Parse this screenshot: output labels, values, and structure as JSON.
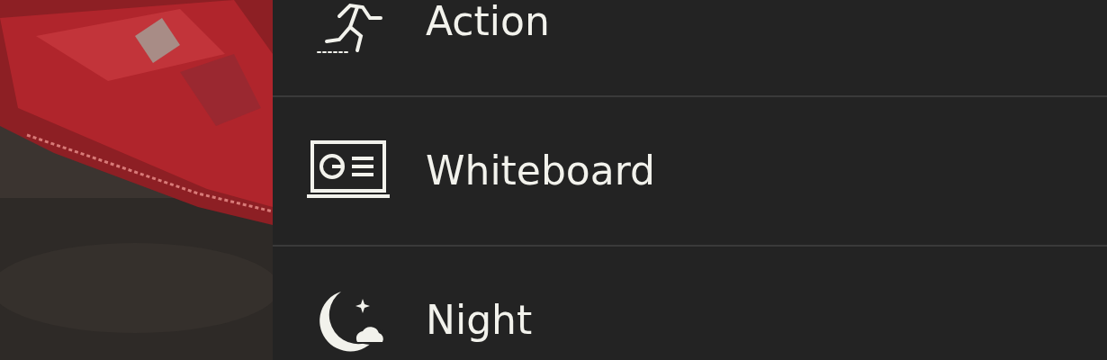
{
  "scene_modes": [
    {
      "label": "Action",
      "kind": "action"
    },
    {
      "label": "Whiteboard",
      "kind": "whiteboard"
    },
    {
      "label": "Night",
      "kind": "night"
    }
  ]
}
